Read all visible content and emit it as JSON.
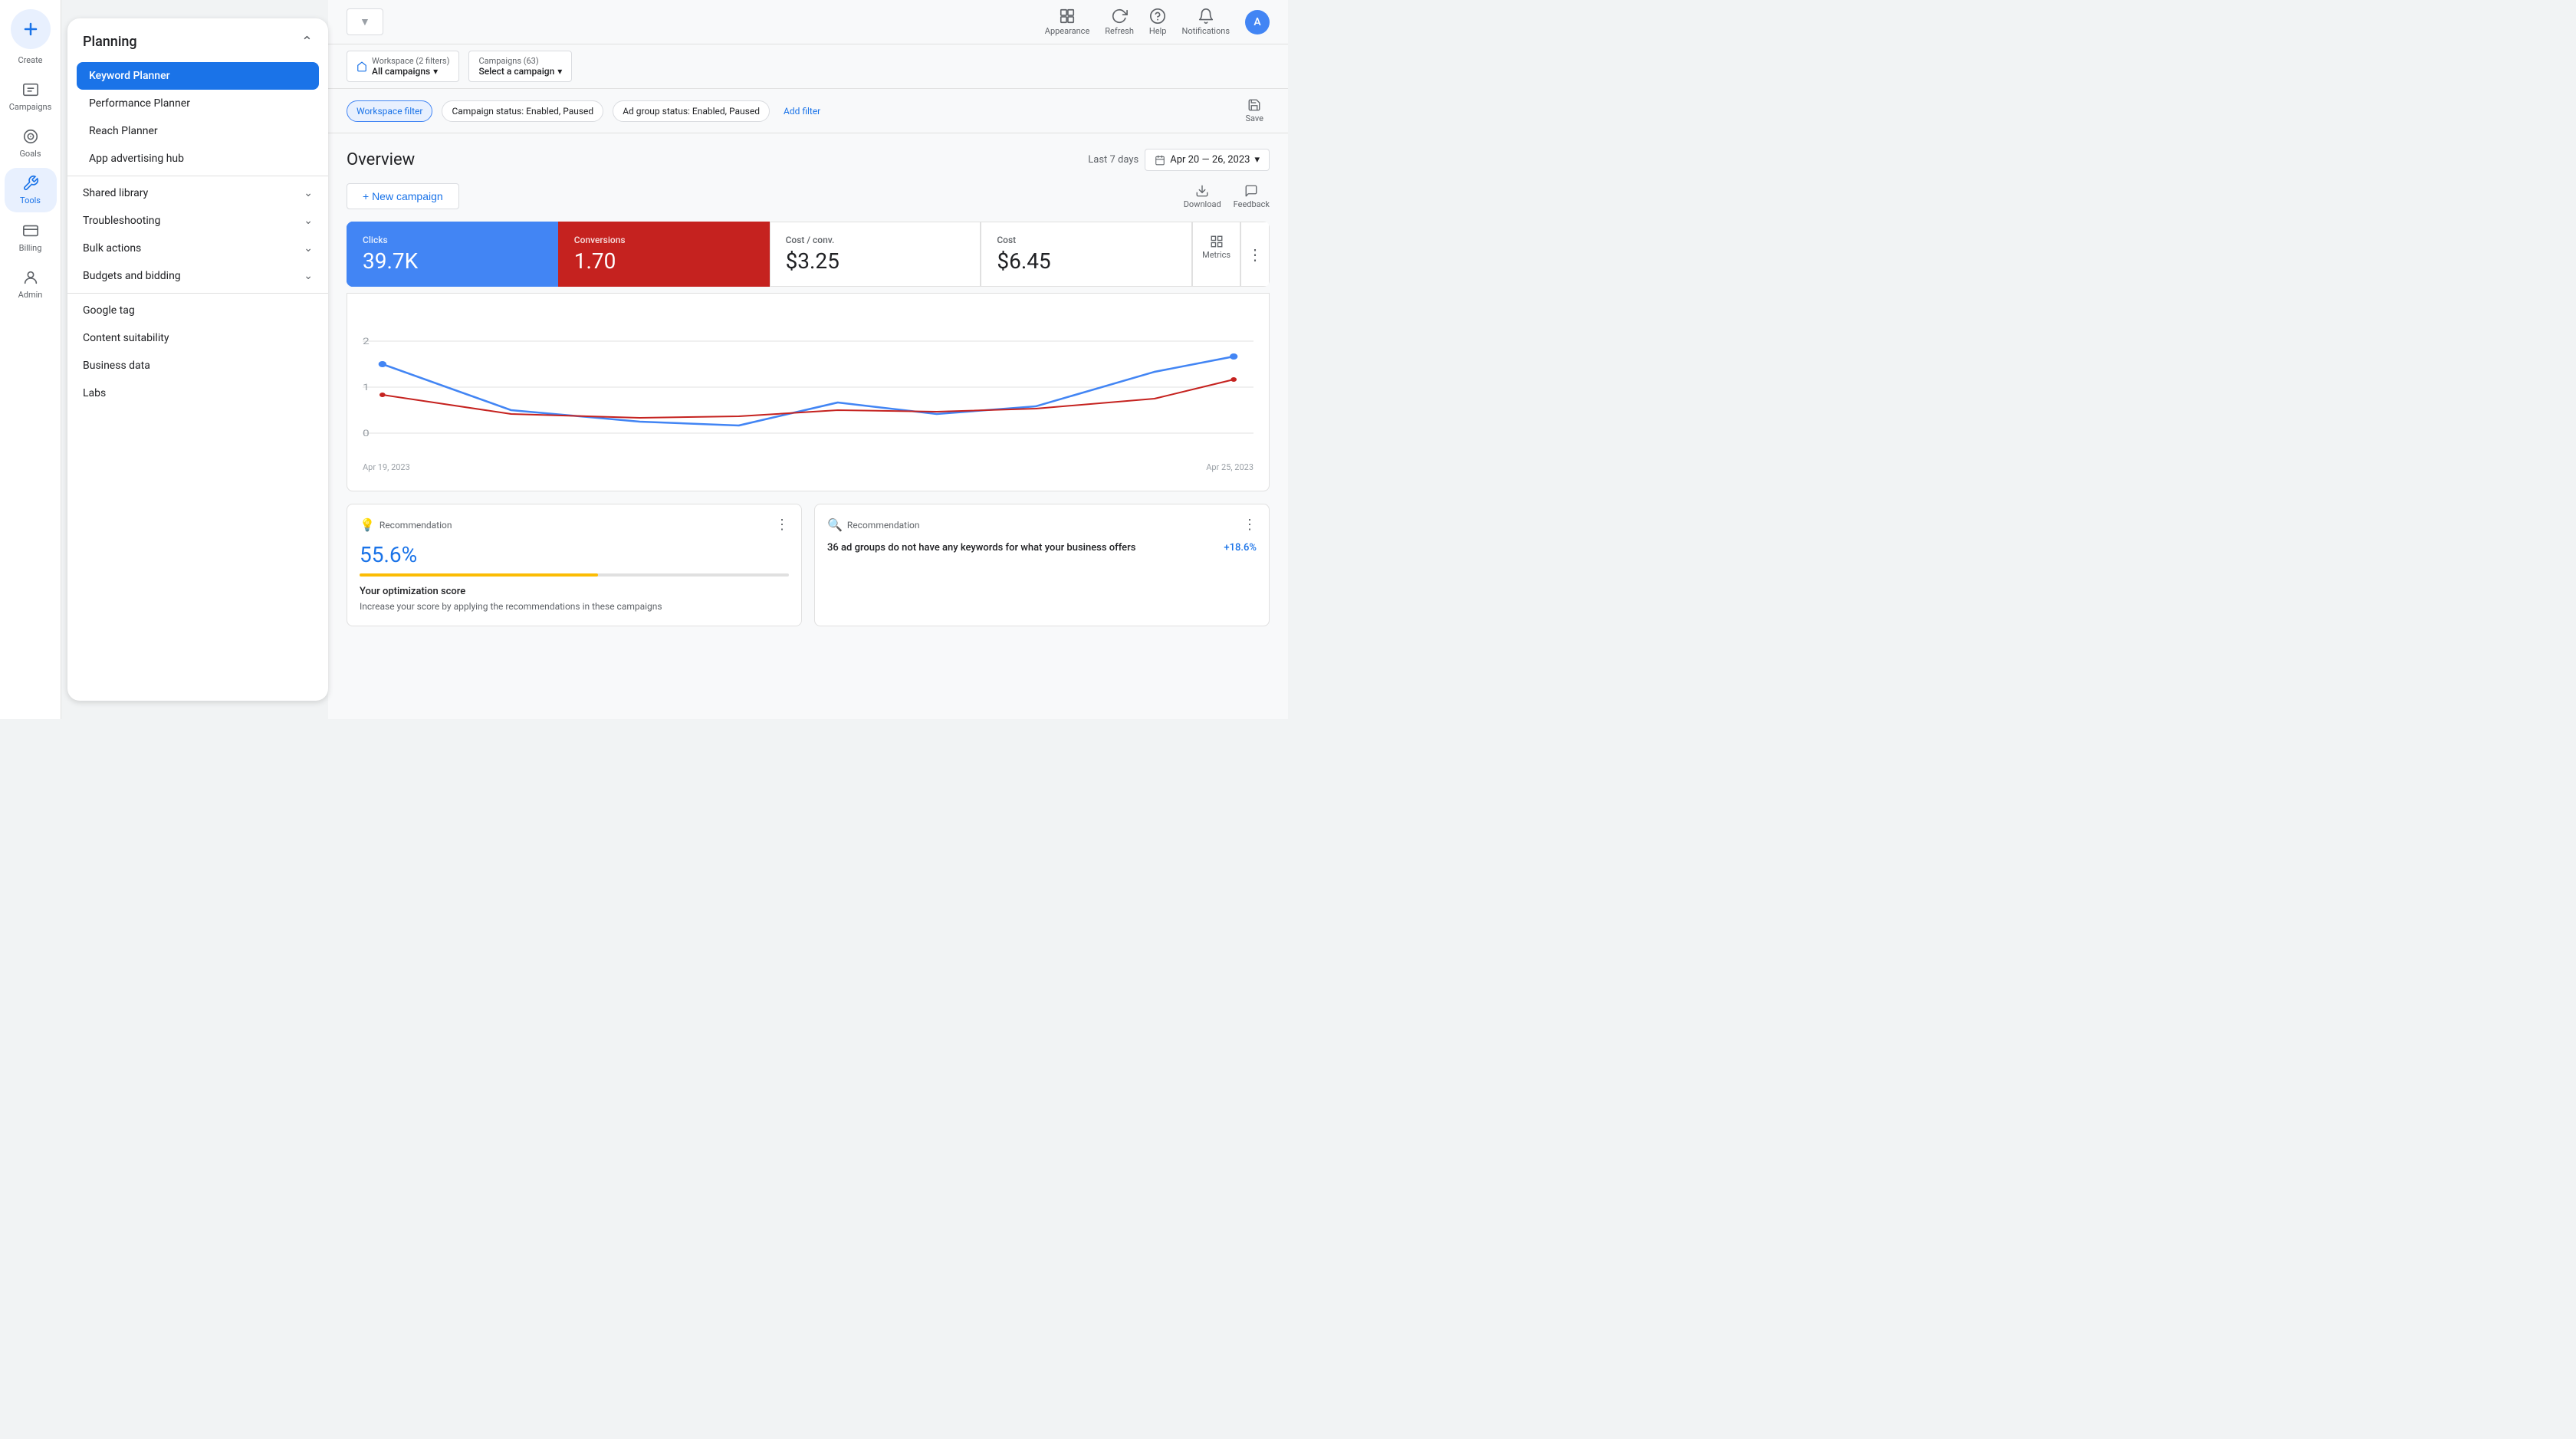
{
  "sidebar": {
    "create_label": "Create",
    "campaigns_label": "Campaigns",
    "goals_label": "Goals",
    "tools_label": "Tools",
    "billing_label": "Billing",
    "admin_label": "Admin"
  },
  "planning_panel": {
    "title": "Planning",
    "close_icon": "×",
    "items": [
      {
        "label": "Keyword Planner",
        "active": true
      },
      {
        "label": "Performance Planner",
        "active": false
      },
      {
        "label": "Reach Planner",
        "active": false
      },
      {
        "label": "App advertising hub",
        "active": false
      }
    ],
    "sections": [
      {
        "label": "Shared library",
        "expandable": true
      },
      {
        "label": "Troubleshooting",
        "expandable": true
      },
      {
        "label": "Bulk actions",
        "expandable": true
      },
      {
        "label": "Budgets and bidding",
        "expandable": true
      },
      {
        "label": "Google tag",
        "expandable": false
      },
      {
        "label": "Content suitability",
        "expandable": false
      },
      {
        "label": "Business data",
        "expandable": false
      },
      {
        "label": "Labs",
        "expandable": false
      }
    ]
  },
  "topbar": {
    "dropdown_label": "",
    "dropdown_placeholder": "▼",
    "workspace_label": "Workspace (2 filters)",
    "workspace_sublabel": "All campaigns",
    "campaigns_label": "Campaigns (63)",
    "campaigns_sublabel": "Select a campaign",
    "appearance_label": "Appearance",
    "refresh_label": "Refresh",
    "help_label": "Help",
    "notifications_label": "Notifications",
    "avatar_initial": "A"
  },
  "filterbar": {
    "workspace_filter": "Workspace filter",
    "campaign_status": "Campaign status: Enabled, Paused",
    "ad_group_status": "Ad group status: Enabled, Paused",
    "add_filter": "Add filter",
    "save_label": "Save"
  },
  "overview": {
    "title": "Overview",
    "date_range_label": "Last 7 days",
    "date_value": "Apr 20 — 26, 2023",
    "new_campaign_label": "+ New campaign",
    "download_label": "Download",
    "feedback_label": "Feedback",
    "metrics_label": "Metrics"
  },
  "metrics": [
    {
      "label": "Clicks",
      "value": "39.7K",
      "type": "blue"
    },
    {
      "label": "Conversions",
      "value": "1.70",
      "type": "red"
    },
    {
      "label": "Cost / conv.",
      "value": "$3.25",
      "type": "normal"
    },
    {
      "label": "Cost",
      "value": "$6.45",
      "type": "normal"
    }
  ],
  "chart": {
    "y_labels": [
      "0",
      "1",
      "2"
    ],
    "x_label_left": "Apr 19, 2023",
    "x_label_right": "Apr 25, 2023"
  },
  "recommendations": [
    {
      "label": "Recommendation",
      "score": "55.6%",
      "bar_width": "55.6",
      "title": "Your optimization score",
      "description": "Increase your score by applying the recommendations in these campaigns",
      "icon_type": "bulb"
    },
    {
      "label": "Recommendation",
      "percentage": "+18.6%",
      "title": "36 ad groups do not have any keywords for what your business offers",
      "icon_type": "search",
      "icon_color": "red"
    }
  ]
}
